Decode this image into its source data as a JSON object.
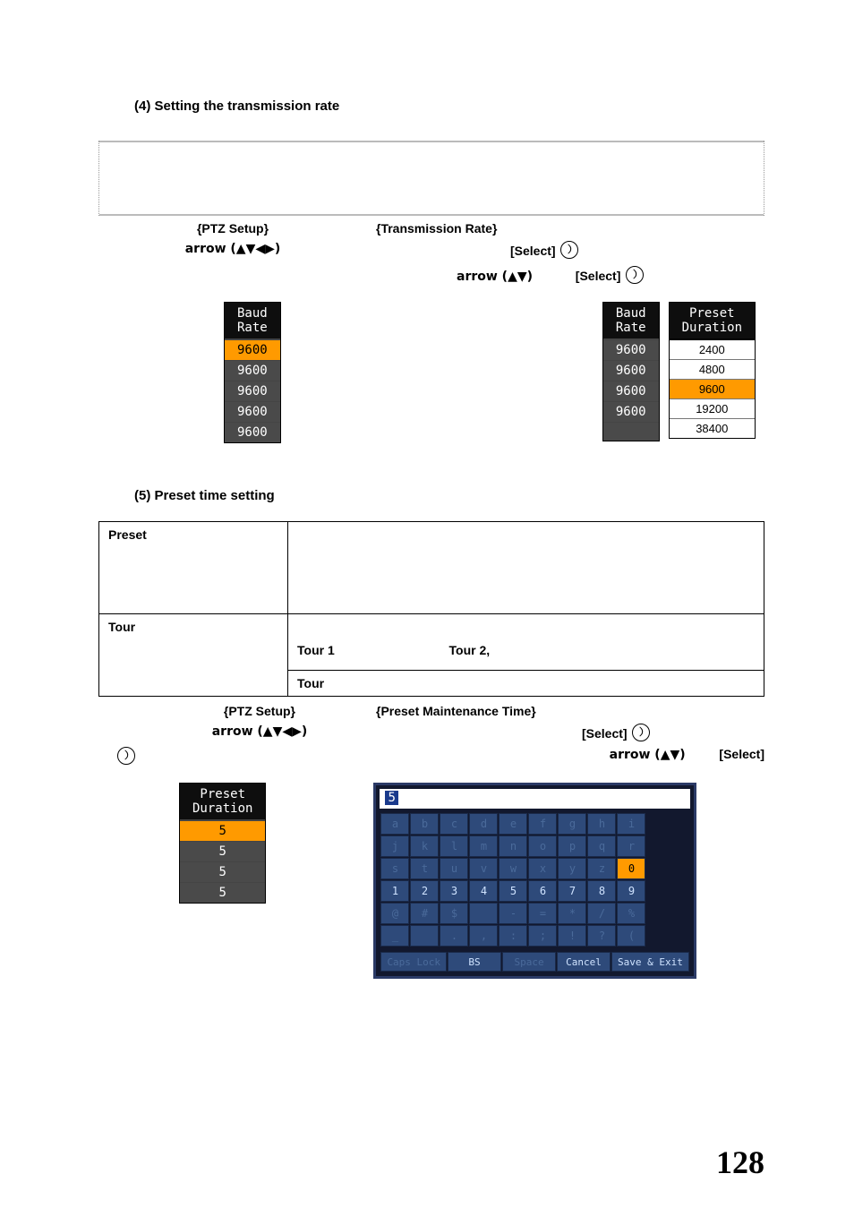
{
  "section4": {
    "title": "(4) Setting the transmission rate",
    "left_label": "{PTZ Setup}",
    "left_arrow": "arrow (▲▼◀▶)",
    "right_label": "{Transmission Rate}",
    "right_select": "[Select]",
    "sub_arrow": "arrow (▲▼)",
    "sub_select": "[Select]",
    "baud_widget": {
      "header": "Baud\nRate",
      "highlight_index": 0,
      "values": [
        "9600",
        "9600",
        "9600",
        "9600",
        "9600"
      ]
    },
    "baud_pair_left": {
      "header": "Baud\nRate",
      "values": [
        "9600",
        "9600",
        "9600",
        "9600",
        ""
      ]
    },
    "baud_pair_right": {
      "header": "Preset\nDuration",
      "options": [
        "2400",
        "4800",
        "9600",
        "19200",
        "38400"
      ],
      "highlight_index": 2
    }
  },
  "section5": {
    "title": "(5) Preset time setting",
    "table": {
      "row1_label": "Preset",
      "row1_text": "",
      "row2_label": "Tour",
      "row2_text_top": "",
      "row2_text_mid_left": "Tour 1",
      "row2_text_mid_right": "Tour 2,",
      "row3_text": "Tour"
    },
    "labels": {
      "left": "{PTZ Setup}",
      "arrow4": "arrow (▲▼◀▶)",
      "right": "{Preset Maintenance Time}",
      "select": "[Select]",
      "arrow2": "arrow (▲▼)",
      "select2": "[Select]"
    },
    "preset_widget": {
      "header": "Preset\nDuration",
      "highlight_index": 0,
      "values": [
        "5",
        "5",
        "5",
        "5"
      ]
    },
    "keyboard": {
      "entry": "5",
      "rows_dim": [
        [
          "a",
          "b",
          "c",
          "d",
          "e",
          "f",
          "g",
          "h",
          "i"
        ],
        [
          "j",
          "k",
          "l",
          "m",
          "n",
          "o",
          "p",
          "q",
          "r"
        ],
        [
          "s",
          "t",
          "u",
          "v",
          "w",
          "x",
          "y",
          "z"
        ]
      ],
      "zero": "0",
      "nums": [
        "1",
        "2",
        "3",
        "4",
        "5",
        "6",
        "7",
        "8",
        "9"
      ],
      "sym1": [
        "@",
        "#",
        "$",
        " ",
        "-",
        "=",
        "*",
        "/",
        "%"
      ],
      "sym2": [
        "_",
        " ",
        ".",
        ",",
        ":",
        ";",
        "!",
        "?",
        "(",
        ")"
      ],
      "btns": {
        "caps": "Caps Lock",
        "bs": "BS",
        "space": "Space",
        "cancel": "Cancel",
        "save": "Save & Exit"
      }
    }
  },
  "page_number": "128"
}
